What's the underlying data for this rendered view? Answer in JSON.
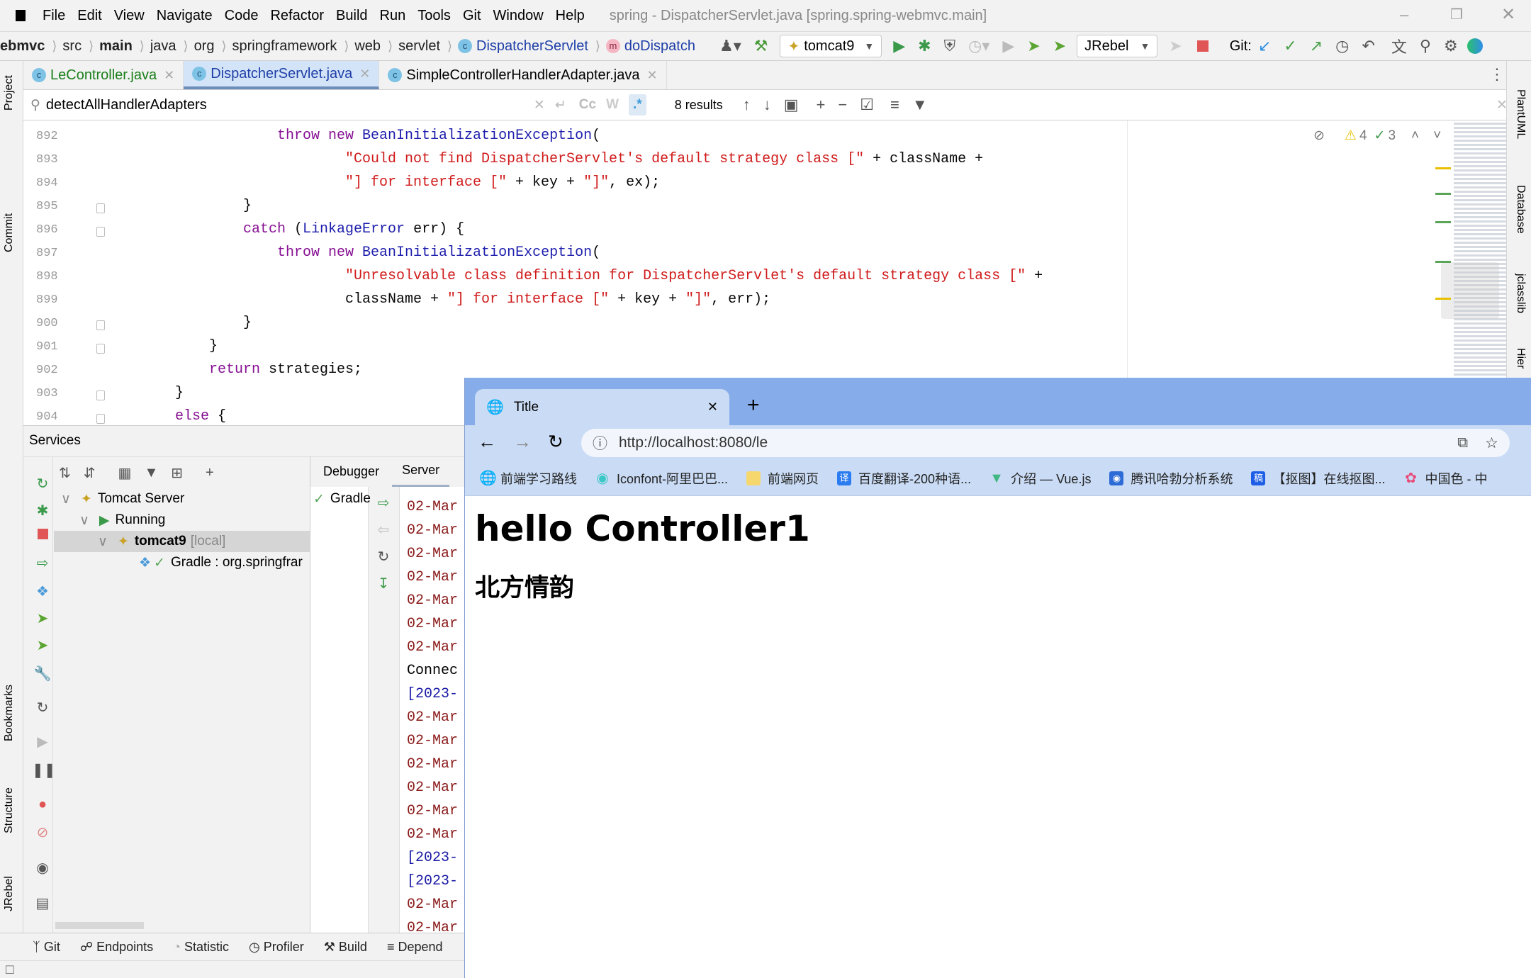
{
  "menu": {
    "items": [
      "File",
      "Edit",
      "View",
      "Navigate",
      "Code",
      "Refactor",
      "Build",
      "Run",
      "Tools",
      "Git",
      "Window",
      "Help"
    ],
    "window_title": "spring - DispatcherServlet.java [spring.spring-webmvc.main]"
  },
  "breadcrumb": [
    "ebmvc",
    "src",
    "main",
    "java",
    "org",
    "springframework",
    "web",
    "servlet",
    "DispatcherServlet",
    "doDispatch"
  ],
  "toolbar": {
    "run_config": "tomcat9",
    "jrebel": "JRebel",
    "git_label": "Git:"
  },
  "tabs": [
    {
      "label": "LeController.java",
      "color": "#1a7f1a"
    },
    {
      "label": "DispatcherServlet.java",
      "color": "#1f3fa8",
      "active": true
    },
    {
      "label": "SimpleControllerHandlerAdapter.java",
      "color": "#000000"
    }
  ],
  "search": {
    "query": "detectAllHandlerAdapters",
    "results": "8 results",
    "case": "Cc",
    "word": "W",
    "regex": ".*"
  },
  "inspections": {
    "warnings": "4",
    "ok": "3"
  },
  "code": [
    {
      "n": "892",
      "ind": 20,
      "t": [
        [
          "throw new ",
          "kw"
        ],
        [
          "BeanInitializationException",
          "cls"
        ],
        [
          "(",
          ""
        ]
      ]
    },
    {
      "n": "893",
      "ind": 28,
      "t": [
        [
          "\"Could not find DispatcherServlet's default strategy class [\"",
          "str"
        ],
        [
          " + className +",
          ""
        ]
      ]
    },
    {
      "n": "894",
      "ind": 28,
      "t": [
        [
          "\"] for interface [\"",
          "str"
        ],
        [
          " + key + ",
          ""
        ],
        [
          "\"]\"",
          "str"
        ],
        [
          ", ex);",
          ""
        ]
      ]
    },
    {
      "n": "895",
      "ind": 16,
      "t": [
        [
          "}",
          ""
        ]
      ]
    },
    {
      "n": "896",
      "ind": 16,
      "t": [
        [
          "catch",
          "kw"
        ],
        [
          " (",
          ""
        ],
        [
          "LinkageError",
          "cls"
        ],
        [
          " err) {",
          ""
        ]
      ]
    },
    {
      "n": "897",
      "ind": 20,
      "t": [
        [
          "throw new ",
          "kw"
        ],
        [
          "BeanInitializationException",
          "cls"
        ],
        [
          "(",
          ""
        ]
      ]
    },
    {
      "n": "898",
      "ind": 28,
      "t": [
        [
          "\"Unresolvable class definition for DispatcherServlet's default strategy class [\"",
          "str"
        ],
        [
          " +",
          ""
        ]
      ]
    },
    {
      "n": "899",
      "ind": 28,
      "t": [
        [
          "className + ",
          ""
        ],
        [
          "\"] for interface [\"",
          "str"
        ],
        [
          " + key + ",
          ""
        ],
        [
          "\"]\"",
          "str"
        ],
        [
          ", err);",
          ""
        ]
      ]
    },
    {
      "n": "900",
      "ind": 16,
      "t": [
        [
          "}",
          ""
        ]
      ]
    },
    {
      "n": "901",
      "ind": 12,
      "t": [
        [
          "}",
          ""
        ]
      ]
    },
    {
      "n": "902",
      "ind": 12,
      "t": [
        [
          "return",
          "kw"
        ],
        [
          " strategies;",
          ""
        ]
      ]
    },
    {
      "n": "903",
      "ind": 8,
      "t": [
        [
          "}",
          ""
        ]
      ]
    },
    {
      "n": "904",
      "ind": 8,
      "t": [
        [
          "else",
          "kw"
        ],
        [
          " {",
          ""
        ]
      ]
    }
  ],
  "services": {
    "title": "Services",
    "tree": [
      "Tomcat Server",
      "Running",
      "tomcat9",
      "[local]",
      "Gradle : org.springfrar"
    ],
    "tabs": [
      "Debugger",
      "Server"
    ],
    "gradle": "Gradle"
  },
  "console": [
    {
      "t": "02-Mar",
      "c": "#8b1a1a"
    },
    {
      "t": "02-Mar",
      "c": "#8b1a1a"
    },
    {
      "t": "02-Mar",
      "c": "#8b1a1a"
    },
    {
      "t": "02-Mar",
      "c": "#8b1a1a"
    },
    {
      "t": "02-Mar",
      "c": "#8b1a1a"
    },
    {
      "t": "02-Mar",
      "c": "#8b1a1a"
    },
    {
      "t": "02-Mar",
      "c": "#8b1a1a"
    },
    {
      "t": "Connec",
      "c": "#000000"
    },
    {
      "t": "[2023-",
      "c": "#1a1aa6"
    },
    {
      "t": "02-Mar",
      "c": "#8b1a1a"
    },
    {
      "t": "02-Mar",
      "c": "#8b1a1a"
    },
    {
      "t": "02-Mar",
      "c": "#8b1a1a"
    },
    {
      "t": "02-Mar",
      "c": "#8b1a1a"
    },
    {
      "t": "02-Mar",
      "c": "#8b1a1a"
    },
    {
      "t": "02-Mar",
      "c": "#8b1a1a"
    },
    {
      "t": "[2023-",
      "c": "#1a1aa6"
    },
    {
      "t": "[2023-",
      "c": "#1a1aa6"
    },
    {
      "t": "02-Mar",
      "c": "#8b1a1a"
    },
    {
      "t": "02-Mar",
      "c": "#8b1a1a"
    },
    {
      "t": "02-Mar",
      "c": "#8b1a1a"
    }
  ],
  "bottom_tabs": [
    "Git",
    "Endpoints",
    "Statistic",
    "Profiler",
    "Build",
    "Depend"
  ],
  "left_tools": [
    "Project",
    "Commit",
    "Bookmarks",
    "Structure",
    "JRebel"
  ],
  "right_tools": [
    "PlantUML",
    "Database",
    "jclasslib",
    "Hier"
  ],
  "browser": {
    "tab_title": "Title",
    "url": "http://localhost:8080/le",
    "bookmarks": [
      {
        "label": "前端学习路线",
        "icon": "globe",
        "color": "#333333"
      },
      {
        "label": "Iconfont-阿里巴巴...",
        "icon": "iconfont",
        "color": "#3cc7c7"
      },
      {
        "label": "前端网页",
        "icon": "folder",
        "color": "#f5d76e"
      },
      {
        "label": "百度翻译-200种语...",
        "icon": "译",
        "color": "#2b7cf0"
      },
      {
        "label": "介绍 — Vue.js",
        "icon": "vue",
        "color": "#41b883"
      },
      {
        "label": "腾讯哈勃分析系统",
        "icon": "habo",
        "color": "#2d6bd6"
      },
      {
        "label": "【抠图】在线抠图...",
        "icon": "稿",
        "color": "#1e5ee6"
      },
      {
        "label": "中国色 - 中",
        "icon": "flower",
        "color": "#e84b7a"
      }
    ],
    "h1": "hello Controller1",
    "h2": "北方情韵"
  }
}
